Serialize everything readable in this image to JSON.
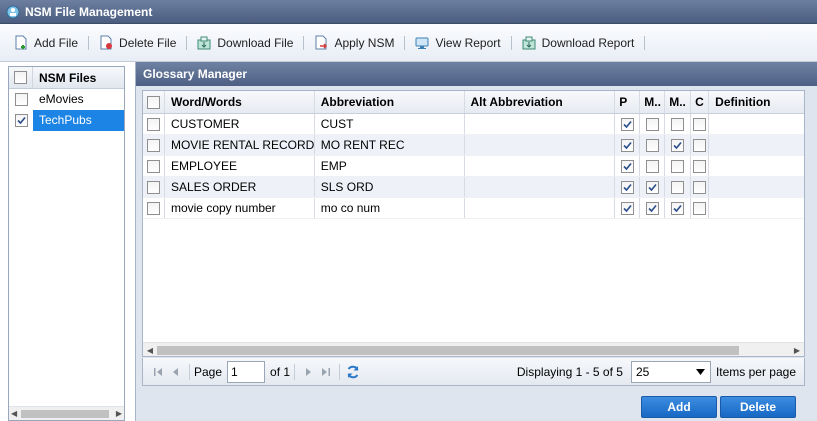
{
  "window": {
    "title": "NSM File Management"
  },
  "toolbar": {
    "add_file": "Add File",
    "delete_file": "Delete File",
    "download_file": "Download File",
    "apply_nsm": "Apply NSM",
    "view_report": "View Report",
    "download_report": "Download Report"
  },
  "nsm_files": {
    "header": "NSM Files",
    "items": [
      {
        "label": "eMovies",
        "checked": false,
        "selected": false
      },
      {
        "label": "TechPubs",
        "checked": true,
        "selected": true
      }
    ]
  },
  "glossary": {
    "title": "Glossary Manager",
    "columns": [
      "Word/Words",
      "Abbreviation",
      "Alt Abbreviation",
      "P",
      "M..",
      "M..",
      "C",
      "Definition"
    ],
    "rows": [
      {
        "word": "CUSTOMER",
        "abbr": "CUST",
        "alt": "",
        "p": true,
        "m1": false,
        "m2": false,
        "c": false,
        "def": ""
      },
      {
        "word": "MOVIE RENTAL RECORD",
        "abbr": "MO RENT REC",
        "alt": "",
        "p": true,
        "m1": false,
        "m2": true,
        "c": false,
        "def": ""
      },
      {
        "word": "EMPLOYEE",
        "abbr": "EMP",
        "alt": "",
        "p": true,
        "m1": false,
        "m2": false,
        "c": false,
        "def": ""
      },
      {
        "word": "SALES ORDER",
        "abbr": "SLS ORD",
        "alt": "",
        "p": true,
        "m1": true,
        "m2": false,
        "c": false,
        "def": ""
      },
      {
        "word": "movie copy number",
        "abbr": "mo co num",
        "alt": "",
        "p": true,
        "m1": true,
        "m2": true,
        "c": false,
        "def": ""
      }
    ]
  },
  "pager": {
    "page_label": "Page",
    "page_value": "1",
    "of_label": "of 1",
    "displaying": "Displaying 1 - 5 of 5",
    "page_size": "25",
    "items_per_page": "Items per page"
  },
  "actions": {
    "add": "Add",
    "delete": "Delete"
  },
  "colors": {
    "title_bar": "#4a5d80",
    "selection": "#1c84e4",
    "button": "#1668c4"
  }
}
